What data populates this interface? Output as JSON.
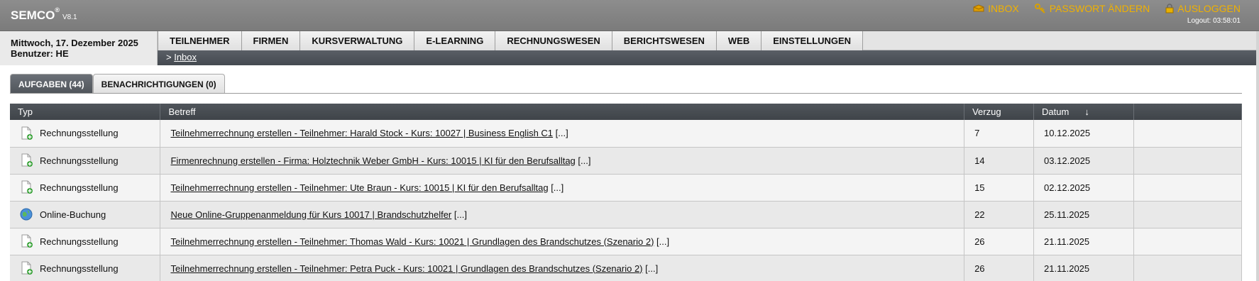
{
  "app": {
    "name": "SEMCO",
    "trademark": "®",
    "version": "V8.1"
  },
  "topnav": {
    "inbox": "INBOX",
    "password": "PASSWORT ÄNDERN",
    "logout": "AUSLOGGEN",
    "logout_timer": "Logout: 03:58:01"
  },
  "info": {
    "date": "Mittwoch, 17. Dezember 2025",
    "user": "Benutzer: HE"
  },
  "menu": [
    {
      "label": "TEILNEHMER"
    },
    {
      "label": "FIRMEN"
    },
    {
      "label": "KURSVERWALTUNG"
    },
    {
      "label": "E-LEARNING"
    },
    {
      "label": "RECHNUNGSWESEN"
    },
    {
      "label": "BERICHTSWESEN"
    },
    {
      "label": "WEB"
    },
    {
      "label": "EINSTELLUNGEN"
    }
  ],
  "breadcrumb": {
    "prefix": ">",
    "current": "Inbox"
  },
  "tabs": [
    {
      "label": "AUFGABEN (44)",
      "active": true
    },
    {
      "label": "BENACHRICHTIGUNGEN (0)",
      "active": false
    }
  ],
  "table": {
    "headers": {
      "typ": "Typ",
      "betreff": "Betreff",
      "verzug": "Verzug",
      "datum": "Datum",
      "sort": "↓"
    },
    "rows": [
      {
        "icon": "invoice-add-icon",
        "typ": "Rechnungsstellung",
        "betreff": "Teilnehmerrechnung erstellen - Teilnehmer: Harald Stock - Kurs: 10027 | Business English C1",
        "more": "[...]",
        "verzug": "7",
        "datum": "10.12.2025"
      },
      {
        "icon": "invoice-add-icon",
        "typ": "Rechnungsstellung",
        "betreff": "Firmenrechnung erstellen - Firma: Holztechnik Weber GmbH - Kurs: 10015 | KI für den Berufsalltag",
        "more": "[...]",
        "verzug": "14",
        "datum": "03.12.2025"
      },
      {
        "icon": "invoice-add-icon",
        "typ": "Rechnungsstellung",
        "betreff": "Teilnehmerrechnung erstellen - Teilnehmer: Ute Braun - Kurs: 10015 | KI für den Berufsalltag",
        "more": "[...]",
        "verzug": "15",
        "datum": "02.12.2025"
      },
      {
        "icon": "globe-icon",
        "typ": "Online-Buchung",
        "betreff": "Neue Online-Gruppenanmeldung für Kurs 10017 | Brandschutzhelfer",
        "more": "[...]",
        "verzug": "22",
        "datum": "25.11.2025"
      },
      {
        "icon": "invoice-add-icon",
        "typ": "Rechnungsstellung",
        "betreff": "Teilnehmerrechnung erstellen - Teilnehmer: Thomas Wald - Kurs: 10021 | Grundlagen des Brandschutzes (Szenario 2)",
        "more": "[...]",
        "verzug": "26",
        "datum": "21.11.2025"
      },
      {
        "icon": "invoice-add-icon",
        "typ": "Rechnungsstellung",
        "betreff": "Teilnehmerrechnung erstellen - Teilnehmer: Petra Puck - Kurs: 10021 | Grundlagen des Brandschutzes (Szenario 2)",
        "more": "[...]",
        "verzug": "26",
        "datum": "21.11.2025"
      }
    ]
  },
  "colors": {
    "accent": "#f0b100",
    "header_dark": "#4a4f55",
    "topbar": "#858585"
  }
}
